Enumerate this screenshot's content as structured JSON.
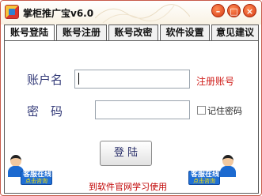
{
  "window": {
    "title": "掌柜推广宝v6.0"
  },
  "title_buttons": {
    "minimize": "–",
    "maximize": "□",
    "close": "×"
  },
  "tabs": [
    {
      "label": "账号登陆",
      "active": true
    },
    {
      "label": "账号注册",
      "active": false
    },
    {
      "label": "账号改密",
      "active": false
    },
    {
      "label": "软件设置",
      "active": false
    },
    {
      "label": "意见建议",
      "active": false
    }
  ],
  "login": {
    "account_label": "账户名",
    "account_value": "",
    "register_link": "注册账号",
    "password_label": "密　码",
    "password_value": "",
    "remember_label": "记住密码",
    "login_button": "登 陆"
  },
  "footer": {
    "website_link": "到软件官网学习使用",
    "service_left": {
      "line1": "客服在线",
      "line2": "点击咨询"
    },
    "service_right": {
      "line1": "客服在线",
      "line2": "点击咨询"
    }
  },
  "colors": {
    "border": "#c85a4a",
    "link_red": "#d0201c",
    "label_blue": "#333a78",
    "badge_blue": "#1f6fd6"
  }
}
